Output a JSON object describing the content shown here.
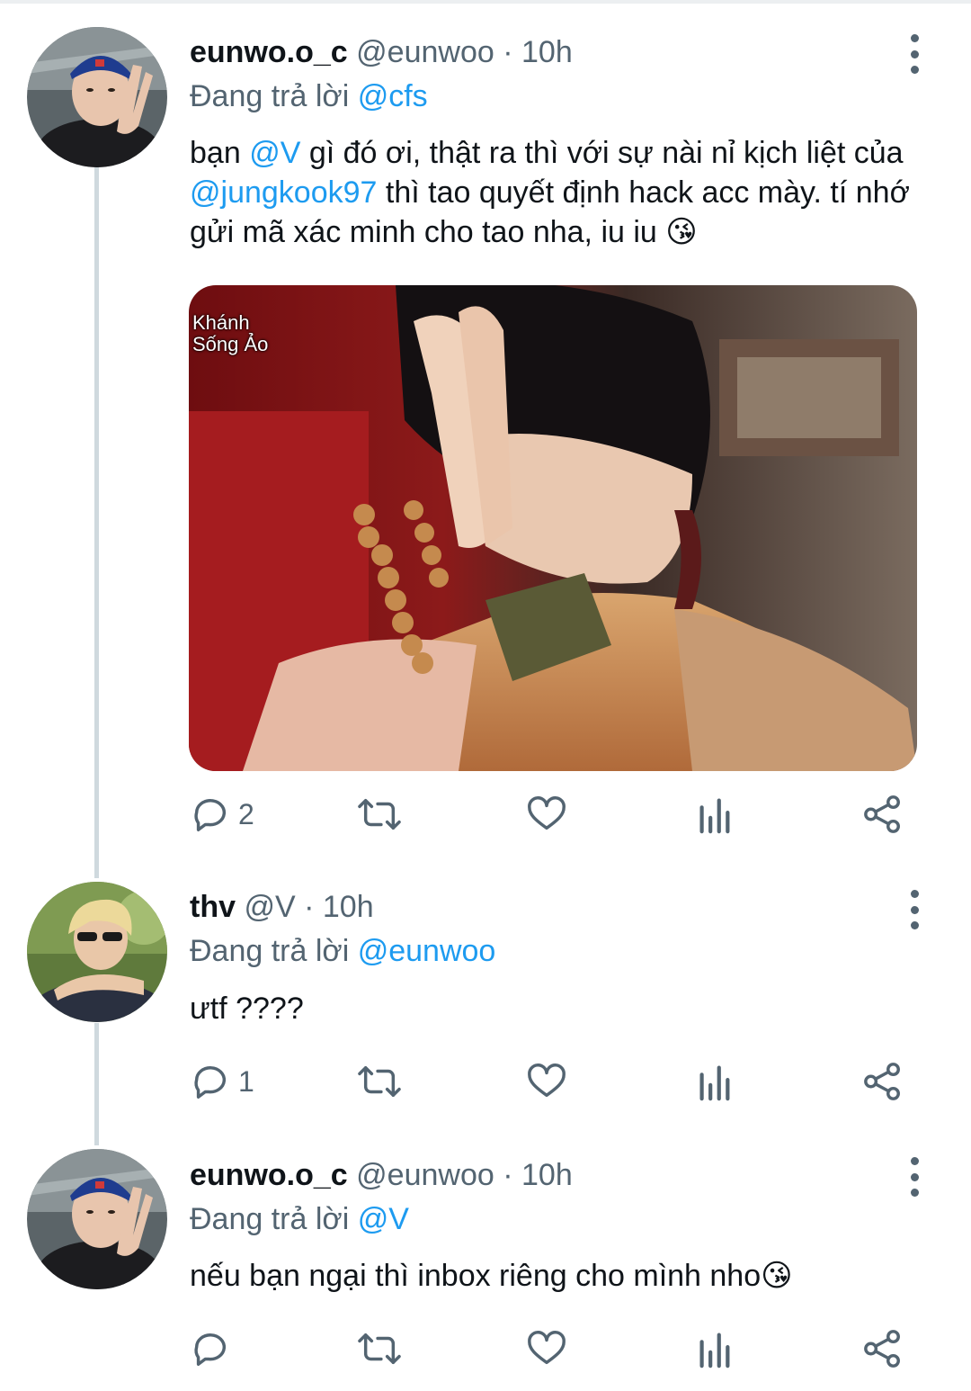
{
  "tweets": [
    {
      "name": "eunwo.o_c",
      "handle": "@eunwoo",
      "sep": "·",
      "time": "10h",
      "reply_prefix": "Đang trả lời",
      "reply_to": "@cfs",
      "text_parts": [
        "bạn ",
        "@V",
        " gì đó ơi, thật ra thì với sự nài nỉ kịch liệt của ",
        "@jungkook97",
        " thì tao quyết định hack acc mày. tí nhớ gửi mã xác minh cho tao nha, iu iu 😘"
      ],
      "media_watermark": "Khánh\nSống Ảo",
      "reply_count": "2",
      "avatar_icon": "user-avatar"
    },
    {
      "name": "thv",
      "handle": "@V",
      "sep": "·",
      "time": "10h",
      "reply_prefix": "Đang trả lời",
      "reply_to": "@eunwoo",
      "text": "ưtf ????",
      "reply_count": "1",
      "avatar_icon": "user-avatar"
    },
    {
      "name": "eunwo.o_c",
      "handle": "@eunwoo",
      "sep": "·",
      "time": "10h",
      "reply_prefix": "Đang trả lời",
      "reply_to": "@V",
      "text": "nếu bạn ngại thì inbox riêng cho mình nho😘",
      "reply_count": "",
      "avatar_icon": "user-avatar"
    }
  ],
  "icons": {
    "reply": "reply-icon",
    "retweet": "retweet-icon",
    "like": "heart-icon",
    "analytics": "analytics-icon",
    "share": "share-icon",
    "more": "more-vertical-icon"
  },
  "colors": {
    "accent": "#1d9bf0",
    "muted": "#536471",
    "thread_line": "#cfd9de"
  }
}
